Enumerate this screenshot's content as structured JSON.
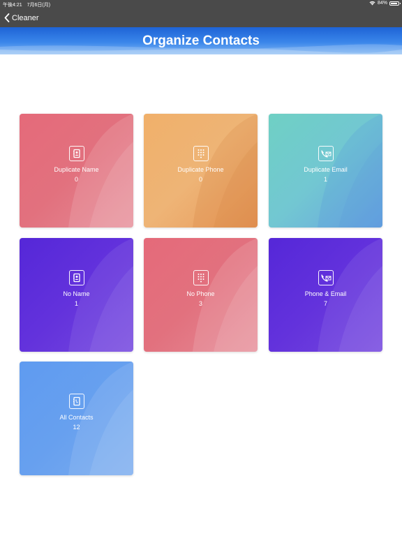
{
  "status_bar": {
    "time": "午後4:21　7月6日(月)",
    "battery": "84%"
  },
  "nav": {
    "back_label": "Cleaner"
  },
  "banner": {
    "title": "Organize Contacts"
  },
  "cards": [
    {
      "label": "Duplicate Name",
      "count": "0",
      "color": "#e56a7a",
      "icon": "address-book-icon"
    },
    {
      "label": "Duplicate Phone",
      "count": "0",
      "color": "#f0b06a",
      "icon": "dialpad-icon"
    },
    {
      "label": "Duplicate Email",
      "count": "1",
      "color": "#6fd0c4",
      "icon": "phone-mail-icon"
    },
    {
      "label": "No Name",
      "count": "1",
      "color": "#5527d8",
      "icon": "address-book-icon"
    },
    {
      "label": "No Phone",
      "count": "3",
      "color": "#e56a7a",
      "icon": "dialpad-icon"
    },
    {
      "label": "Phone & Email",
      "count": "7",
      "color": "#5527d8",
      "icon": "phone-mail-icon"
    },
    {
      "label": "All Contacts",
      "count": "12",
      "color": "#5f9bf0",
      "icon": "contact-book-icon"
    }
  ]
}
